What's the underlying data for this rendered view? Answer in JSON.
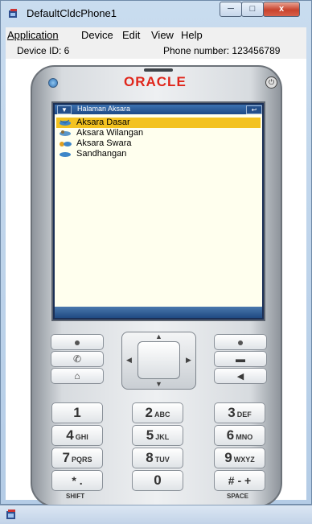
{
  "window": {
    "title": "DefaultCldcPhone1",
    "close_glyph": "x"
  },
  "menu": {
    "items": [
      "Application",
      "Device",
      "Edit",
      "View",
      "Help"
    ]
  },
  "info": {
    "device_id": "Device ID: 6",
    "phone_number": "Phone number: 123456789"
  },
  "phone": {
    "brand": "ORACLE",
    "screen": {
      "title": "Halaman Aksara",
      "items": [
        {
          "label": "Aksara Dasar",
          "selected": true
        },
        {
          "label": "Aksara Wilangan",
          "selected": false
        },
        {
          "label": "Aksara Swara",
          "selected": false
        },
        {
          "label": "Sandhangan",
          "selected": false
        }
      ]
    },
    "keys": {
      "k1": "1",
      "k2": "2",
      "k2_sub": "ABC",
      "k3": "3",
      "k3_sub": "DEF",
      "k4": "4",
      "k4_sub": "GHI",
      "k5": "5",
      "k5_sub": "JKL",
      "k6": "6",
      "k6_sub": "MNO",
      "k7": "7",
      "k7_sub": "PQRS",
      "k8": "8",
      "k8_sub": "TUV",
      "k9": "9",
      "k9_sub": "WXYZ",
      "kstar": "* .",
      "k0": "0",
      "khash": "# - +",
      "shift": "SHIFT",
      "space": "SPACE"
    }
  },
  "icons": {
    "app": "java-cup-icon",
    "call": "phone-call-icon",
    "end": "hang-up-icon",
    "home": "home-icon",
    "clear": "backspace-icon"
  }
}
